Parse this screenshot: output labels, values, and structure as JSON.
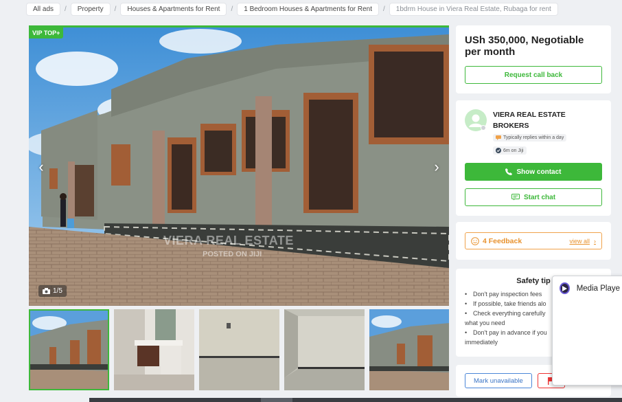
{
  "breadcrumbs": [
    "All ads",
    "Property",
    "Houses & Apartments for Rent",
    "1 Bedroom Houses & Apartments for Rent",
    "1bdrm House in Viera Real Estate, Rubaga for rent"
  ],
  "gallery": {
    "badge": "VIP TOP+",
    "counter": "1/5",
    "watermark": "VIERA REAL ESTATE",
    "watermark_sub": "POSTED ON JIJI",
    "thumb_count": 5
  },
  "price_card": {
    "price": "USh 350,000, Negotiable per month",
    "request_callback": "Request call back"
  },
  "seller": {
    "name_line1": "VIERA REAL ESTATE",
    "name_line2": "BROKERS",
    "reply_badge": "Typically replies within a day",
    "duration_badge": "6m on Jiji",
    "show_contact": "Show contact",
    "start_chat": "Start chat"
  },
  "feedback": {
    "label": "4 Feedback",
    "view_all": "view all"
  },
  "safety": {
    "title": "Safety tip",
    "tips": [
      "Don't pay inspection fees",
      "If possible, take friends alo",
      "Check everything carefully",
      "what you need",
      "Don't pay in advance if you",
      "immediately"
    ]
  },
  "actions": {
    "mark_unavailable": "Mark unavailable"
  },
  "media_player": {
    "label": "Media Playe"
  },
  "colors": {
    "accent_green": "#3db83a",
    "feedback_orange": "#e8922e",
    "link_blue": "#3a74c5"
  }
}
